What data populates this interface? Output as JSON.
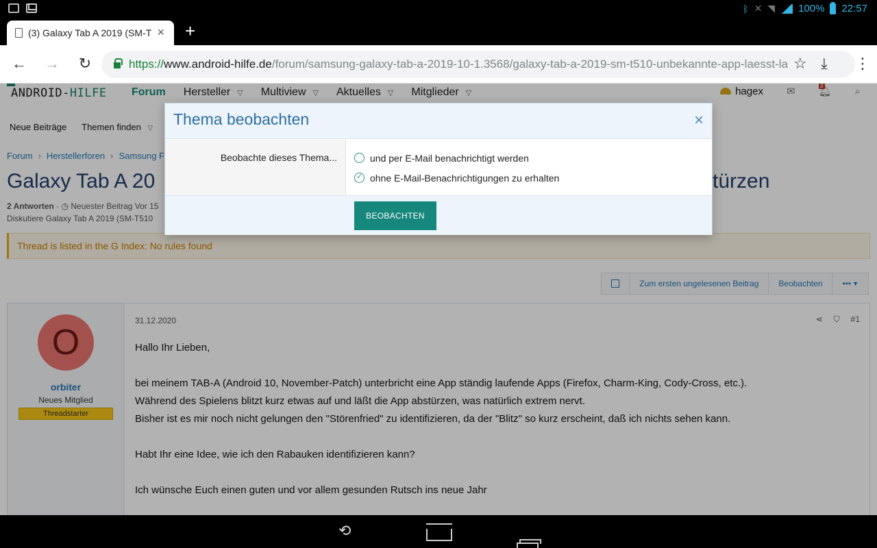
{
  "status_bar": {
    "battery": "100%",
    "time": "22:57"
  },
  "browser": {
    "tab_title": "(3) Galaxy Tab A 2019 (SM-T",
    "tab_close": "×",
    "new_tab": "+",
    "url_proto": "https://",
    "url_host": "www.android-hilfe.de",
    "url_path": "/forum/samsung-galaxy-tab-a-2019-10-1.3568/galaxy-tab-a-2019-sm-t510-unbekannte-app-laesst-la"
  },
  "site": {
    "logo_main": "ANDROID-",
    "logo_accent": "HILFE",
    "nav": [
      "Forum",
      "Hersteller",
      "Multiview",
      "Aktuelles",
      "Mitglieder"
    ],
    "username": "hagex",
    "alert_count": "3",
    "subnav": [
      "Neue Beiträge",
      "Themen finden"
    ],
    "breadcrumb": [
      "Forum",
      "Herstellerforen",
      "Samsung Fo"
    ],
    "thread_title_left": "Galaxy Tab A 20",
    "thread_title_right": "türzen",
    "meta_replies": "2 Antworten",
    "meta_latest": "Neuester Beitrag Vor 15",
    "meta_discuss": "Diskutiere Galaxy Tab A 2019 (SM-T510",
    "notice": "Thread is listed in the G Index: No rules found",
    "thread_buttons": [
      "Zum ersten ungelesenen Beitrag",
      "Beobachten",
      "•••"
    ]
  },
  "post": {
    "avatar_letter": "O",
    "username": "orbiter",
    "user_title": "Neues Mitglied",
    "user_badge": "Threadstarter",
    "date": "31.12.2020",
    "number": "#1",
    "lines": [
      "Hallo Ihr Lieben,",
      "",
      "bei meinem TAB-A (Android 10, November-Patch) unterbricht eine App ständig laufende Apps (Firefox, Charm-King, Cody-Cross, etc.).",
      "Während des Spielens blitzt kurz etwas auf und läßt die App abstürzen, was natürlich extrem nervt.",
      "Bisher ist es mir noch nicht gelungen den \"Störenfried\" zu identifizieren, da der \"Blitz\" so kurz erscheint, daß ich nichts sehen kann.",
      "",
      "Habt Ihr eine Idee, wie ich den Rabauken identifizieren kann?",
      "",
      "Ich wünsche Euch einen guten und vor allem gesunden Rutsch ins neue Jahr"
    ]
  },
  "modal": {
    "title": "Thema beobachten",
    "close": "×",
    "label": "Beobachte dieses Thema...",
    "options": [
      {
        "label": "und per E-Mail benachrichtigt werden",
        "checked": false
      },
      {
        "label": "ohne E-Mail-Benachrichtigungen zu erhalten",
        "checked": true
      }
    ],
    "submit": "BEOBACHTEN"
  },
  "icons": {
    "back": "back-arrow-icon",
    "forward": "forward-arrow-icon",
    "reload": "reload-icon",
    "star": "star-icon",
    "download": "download-icon",
    "menu": "kebab-menu-icon"
  },
  "colors": {
    "accent": "#15877c",
    "link": "#2577b1",
    "modal_title": "#2b6ea3"
  }
}
